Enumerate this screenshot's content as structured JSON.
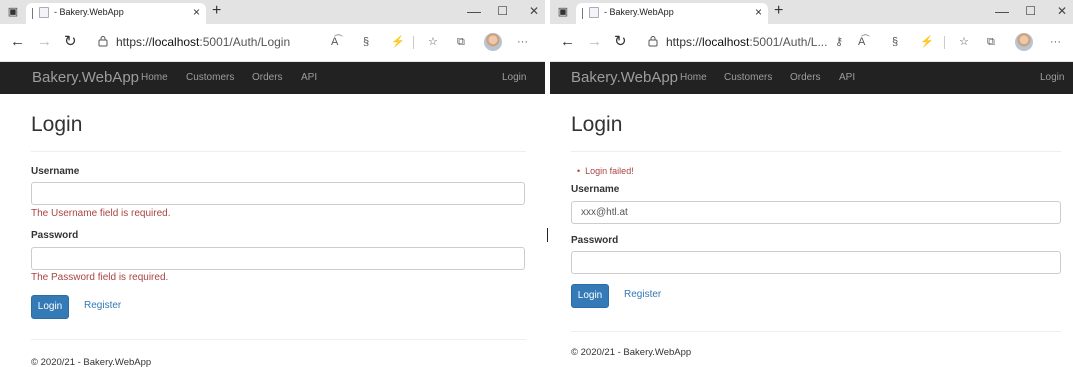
{
  "left": {
    "tab_title": "- Bakery.WebApp",
    "url_scheme": "https://",
    "url_host": "localhost",
    "url_path": ":5001/Auth/Login",
    "brand": "Bakery.WebApp",
    "nav": [
      "Home",
      "Customers",
      "Orders",
      "API"
    ],
    "nav_login": "Login",
    "page_title": "Login",
    "username_label": "Username",
    "username_value": "",
    "username_error": "The Username field is required.",
    "password_label": "Password",
    "password_value": "",
    "password_error": "The Password field is required.",
    "login_button": "Login",
    "register_link": "Register",
    "footer": "© 2020/21 - Bakery.WebApp"
  },
  "right": {
    "tab_title": "- Bakery.WebApp",
    "url_scheme": "https://",
    "url_host": "localhost",
    "url_path": ":5001/Auth/L...",
    "brand": "Bakery.WebApp",
    "nav": [
      "Home",
      "Customers",
      "Orders",
      "API"
    ],
    "nav_login": "Login",
    "page_title": "Login",
    "validation_summary": "Login failed!",
    "username_label": "Username",
    "username_value": "xxx@htl.at",
    "password_label": "Password",
    "password_value": "",
    "login_button": "Login",
    "register_link": "Register",
    "footer": "© 2020/21 - Bakery.WebApp"
  },
  "icons": {
    "tab_close": "×",
    "new_tab": "+",
    "minimize": "—",
    "maximize": "☐",
    "close": "✕",
    "back": "←",
    "forward": "→",
    "reload": "↻",
    "lock": "🔒",
    "more": "···"
  },
  "colors": {
    "navbar_bg": "#222222",
    "navbar_text": "#9d9d9d",
    "error": "#a94442",
    "primary": "#337ab7"
  }
}
